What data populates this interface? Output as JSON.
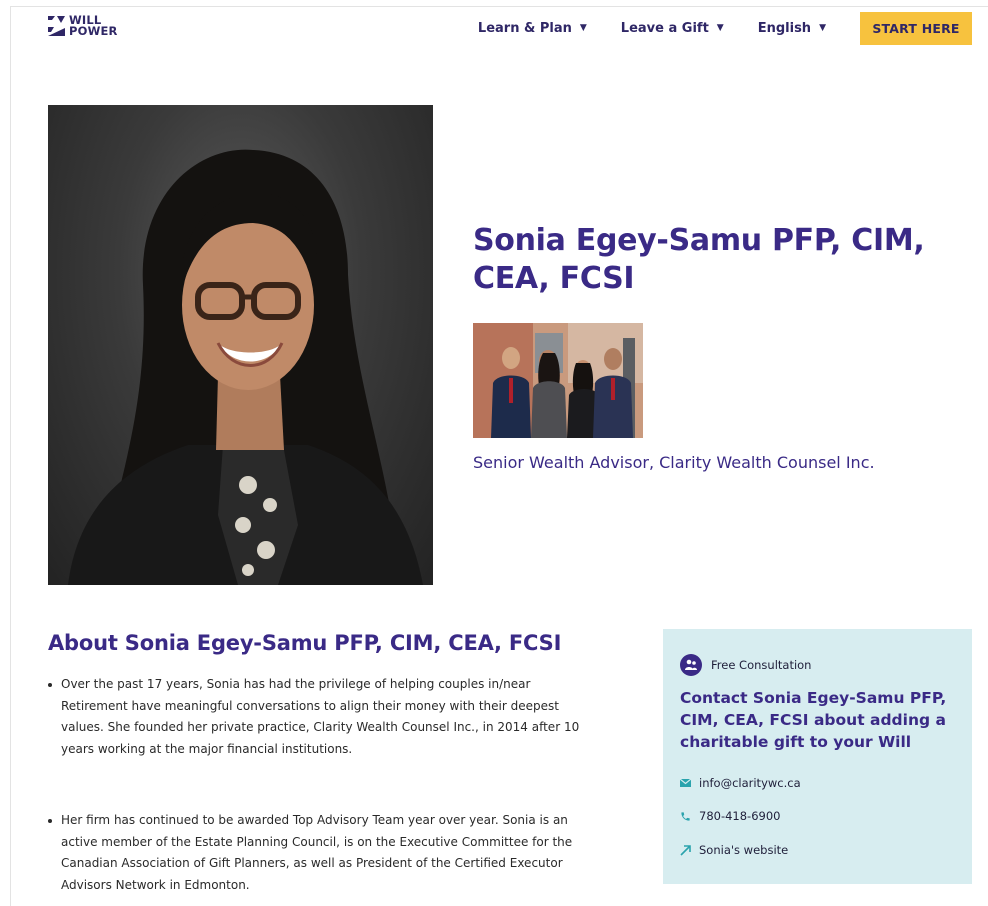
{
  "header": {
    "logo_line1": "WILL",
    "logo_line2": "POWER",
    "nav": [
      {
        "label": "Learn & Plan"
      },
      {
        "label": "Leave a Gift"
      },
      {
        "label": "English"
      }
    ],
    "cta_label": "START HERE"
  },
  "profile": {
    "name_title": "Sonia Egey-Samu PFP, CIM, CEA, FCSI",
    "subtitle": "Senior Wealth Advisor, Clarity Wealth Counsel Inc."
  },
  "about": {
    "heading": "About Sonia Egey-Samu PFP, CIM, CEA, FCSI",
    "paragraphs": [
      "Over the past 17 years, Sonia has had the privilege of helping couples in/near Retirement have meaningful conversations to align their money with their deepest values. She founded her private practice, Clarity Wealth Counsel Inc., in 2014 after 10 years working at the major financial institutions.",
      "Her firm has continued to be awarded Top Advisory Team year over year. Sonia is an active member of the Estate Planning Council, is on the Executive Committee for the Canadian Association of Gift Planners, as well as President of the Certified Executor Advisors Network in Edmonton."
    ]
  },
  "contact_card": {
    "tag": "Free Consultation",
    "heading": "Contact Sonia Egey-Samu PFP, CIM, CEA, FCSI about adding a charitable gift to your Will",
    "email": "info@claritywc.ca",
    "phone": "780-418-6900",
    "website": "Sonia's website"
  },
  "colors": {
    "brand_purple": "#3a2a86",
    "cta_yellow": "#f7c23e",
    "card_bg": "#d7edf0",
    "accent_teal": "#2aa3ad"
  }
}
